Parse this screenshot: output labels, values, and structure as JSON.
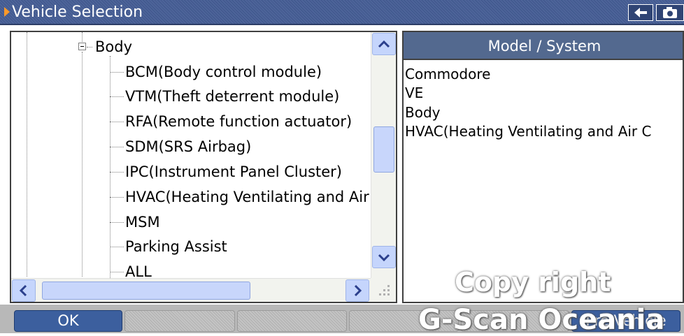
{
  "window": {
    "title": "Vehicle Selection"
  },
  "toolbar": {
    "back_icon": "back-arrow-icon",
    "camera_icon": "camera-icon"
  },
  "tree": {
    "parent": "Body",
    "items": [
      "BCM(Body control module)",
      "VTM(Theft deterrent module)",
      "RFA(Remote function actuator)",
      "SDM(SRS Airbag)",
      "IPC(Instrument Panel Cluster)",
      "HVAC(Heating Ventilating and Air Conditioning)",
      "MSM",
      "Parking Assist",
      "ALL"
    ]
  },
  "model_panel": {
    "header": "Model / System",
    "lines": [
      "Commodore",
      "VE",
      "Body",
      "HVAC(Heating Ventilating and Air C"
    ]
  },
  "buttons": {
    "ok": "OK",
    "pre_vehicle": "Pre Vehicle"
  },
  "watermark": {
    "line1": "Copy right",
    "line2": "G-Scan Oceania"
  },
  "colors": {
    "title_bar": "#4d6499",
    "header": "#53698f",
    "accent_arrow": "#ff9a2a",
    "button_active": "#3c5f9e"
  }
}
